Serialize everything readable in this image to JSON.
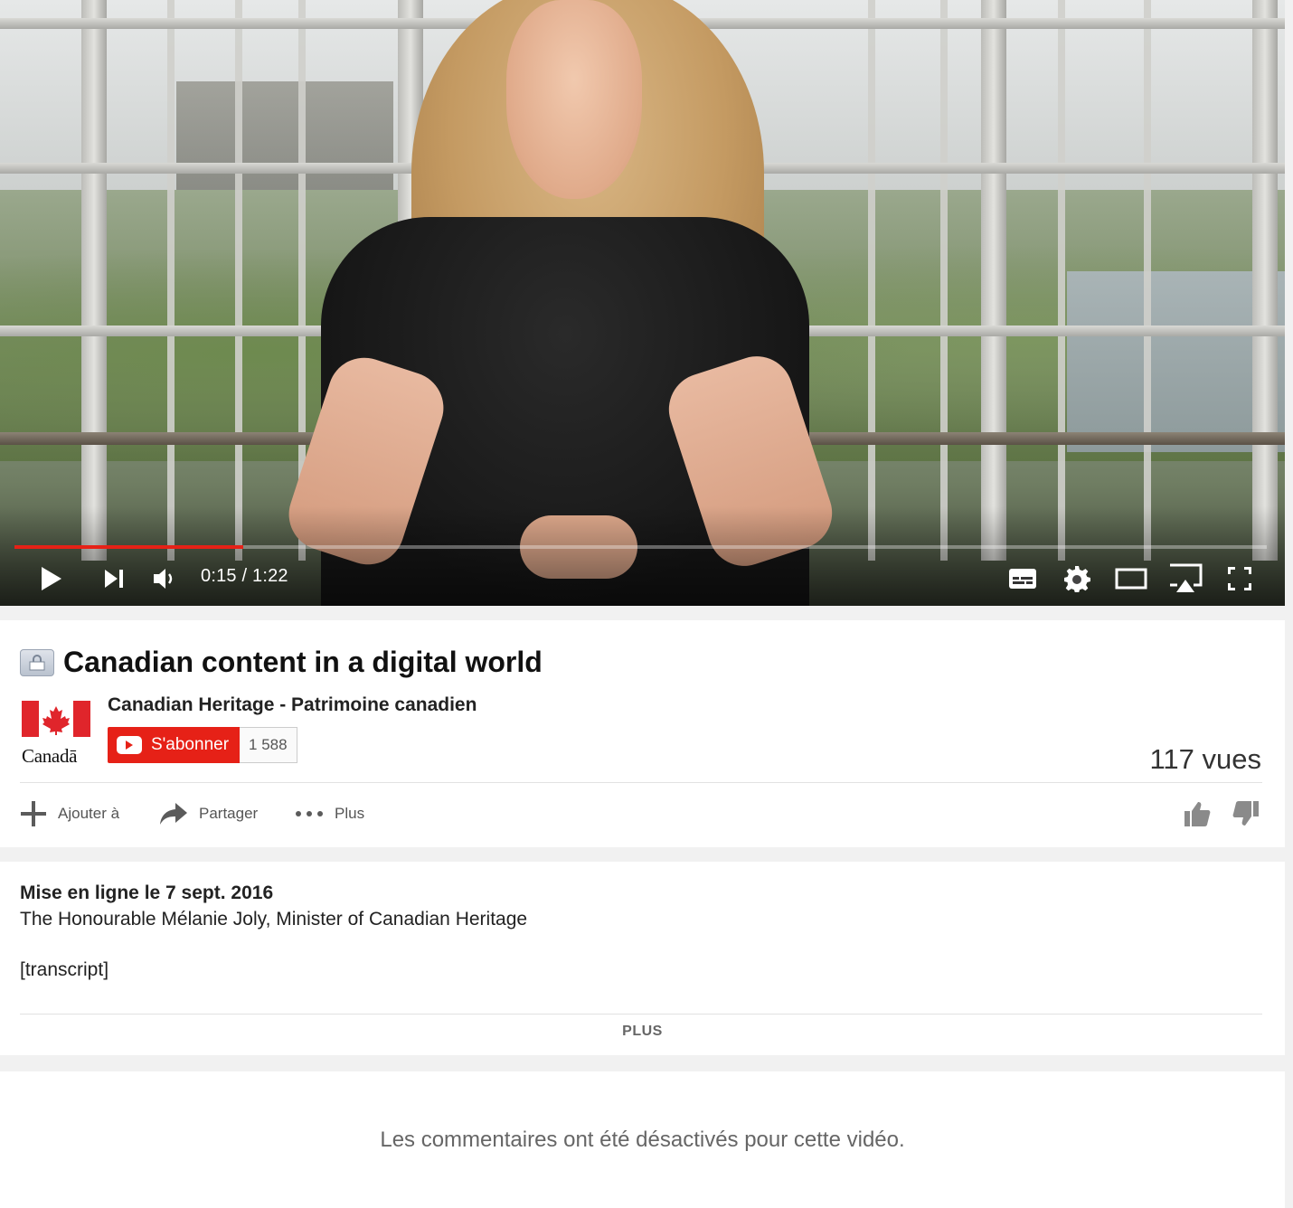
{
  "player": {
    "time_current": "0:15",
    "time_total": "1:22",
    "time_display": "0:15 / 1:22",
    "progress": 0.183,
    "progress_color": "#e62117"
  },
  "video": {
    "title": "Canadian content in a digital world",
    "views": "117 vues"
  },
  "channel": {
    "name": "Canadian Heritage - Patrimoine canadien",
    "logo_text": "Canadā",
    "subscribe_label": "S'abonner",
    "subscriber_count": "1 588"
  },
  "actions": {
    "add_label": "Ajouter à",
    "share_label": "Partager",
    "more_label": "Plus"
  },
  "description": {
    "published": "Mise en ligne le 7 sept. 2016",
    "line1": "The Honourable Mélanie Joly, Minister of Canadian Heritage",
    "line2": "[transcript]",
    "more_label": "PLUS"
  },
  "comments": {
    "disabled_text": "Les commentaires ont été désactivés pour cette vidéo."
  },
  "icons": [
    "play-icon",
    "next-icon",
    "volume-icon",
    "subtitles-icon",
    "settings-icon",
    "theater-mode-icon",
    "airplay-icon",
    "fullscreen-icon",
    "lock-icon",
    "youtube-icon",
    "add-icon",
    "share-icon",
    "more-dots-icon",
    "like-icon",
    "dislike-icon"
  ]
}
